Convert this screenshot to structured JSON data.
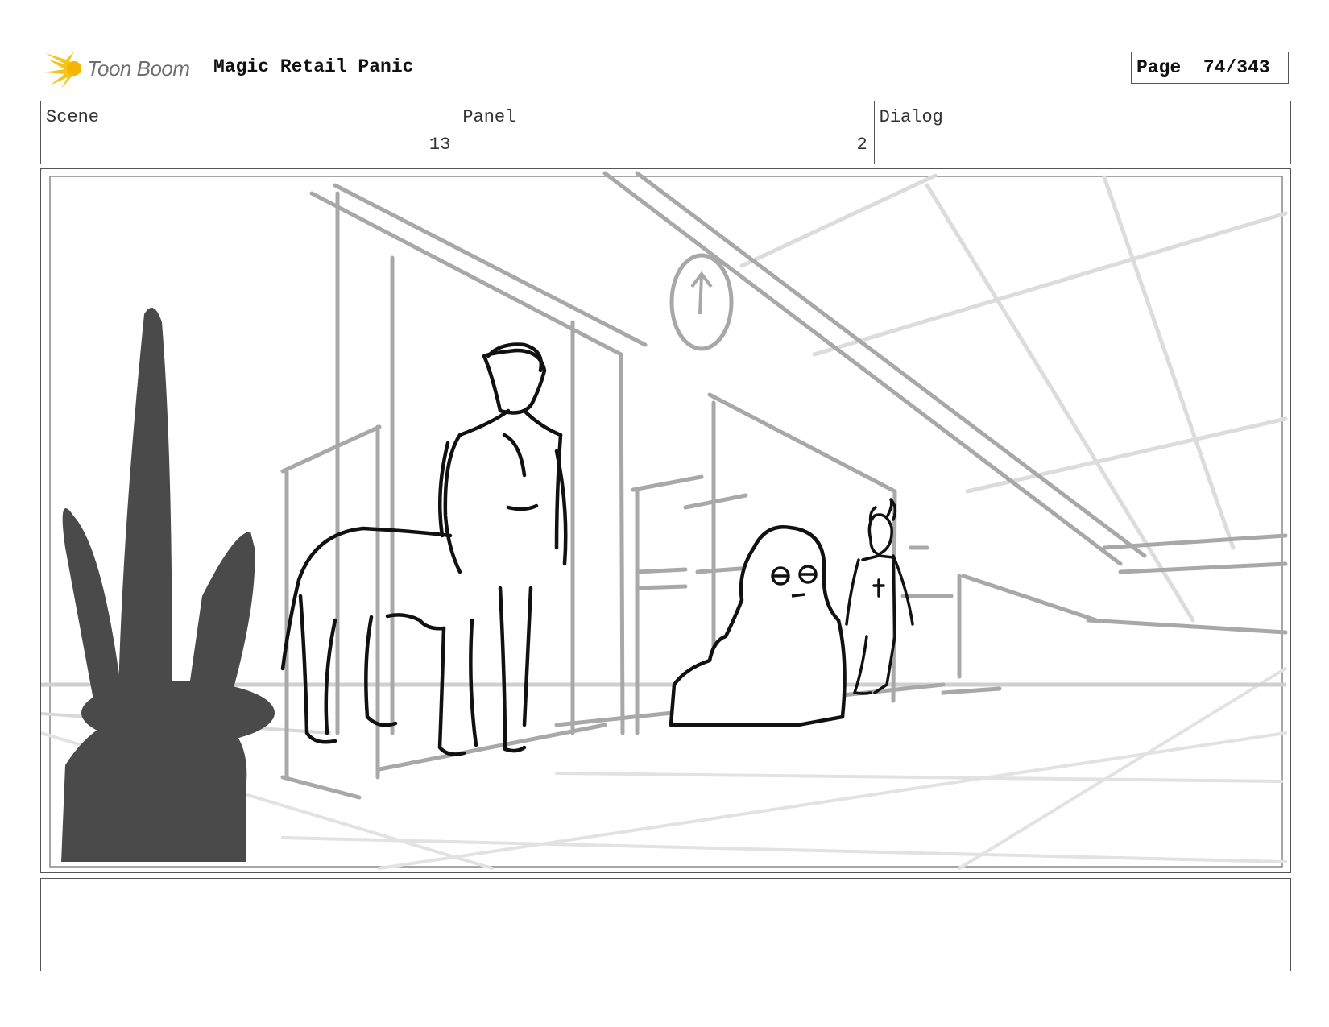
{
  "header": {
    "logo_text": "Toon Boom",
    "project_title": "Magic Retail Panic",
    "page_label": "Page",
    "page_number": "74/343"
  },
  "info": {
    "scene_label": "Scene",
    "scene_value": "13",
    "panel_label": "Panel",
    "panel_value": "2",
    "dialog_label": "Dialog",
    "dialog_value": ""
  },
  "colors": {
    "logo_accent": "#f5c518",
    "sketch_dark": "#111111",
    "sketch_gray": "#a8a8a8",
    "silhouette": "#4a4a4a"
  },
  "notes": {
    "text": ""
  }
}
